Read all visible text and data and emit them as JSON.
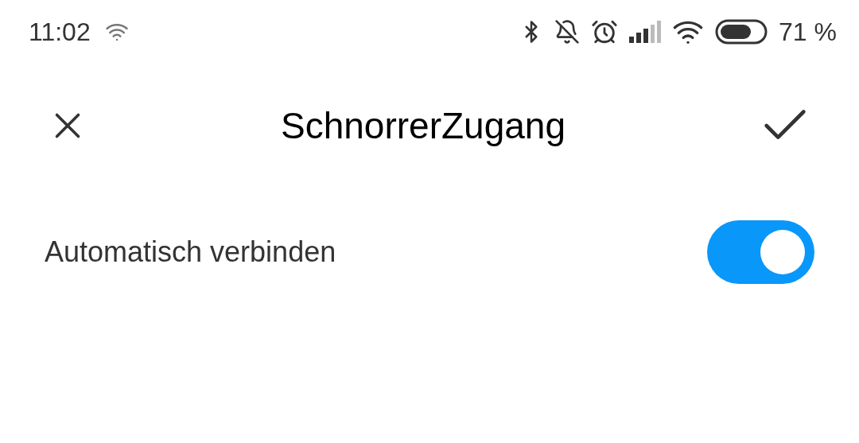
{
  "status_bar": {
    "time": "11:02",
    "battery": "71 %"
  },
  "header": {
    "title": "SchnorrerZugang"
  },
  "settings": [
    {
      "kind": "switch",
      "label": "Automatisch verbinden",
      "on": true
    }
  ]
}
